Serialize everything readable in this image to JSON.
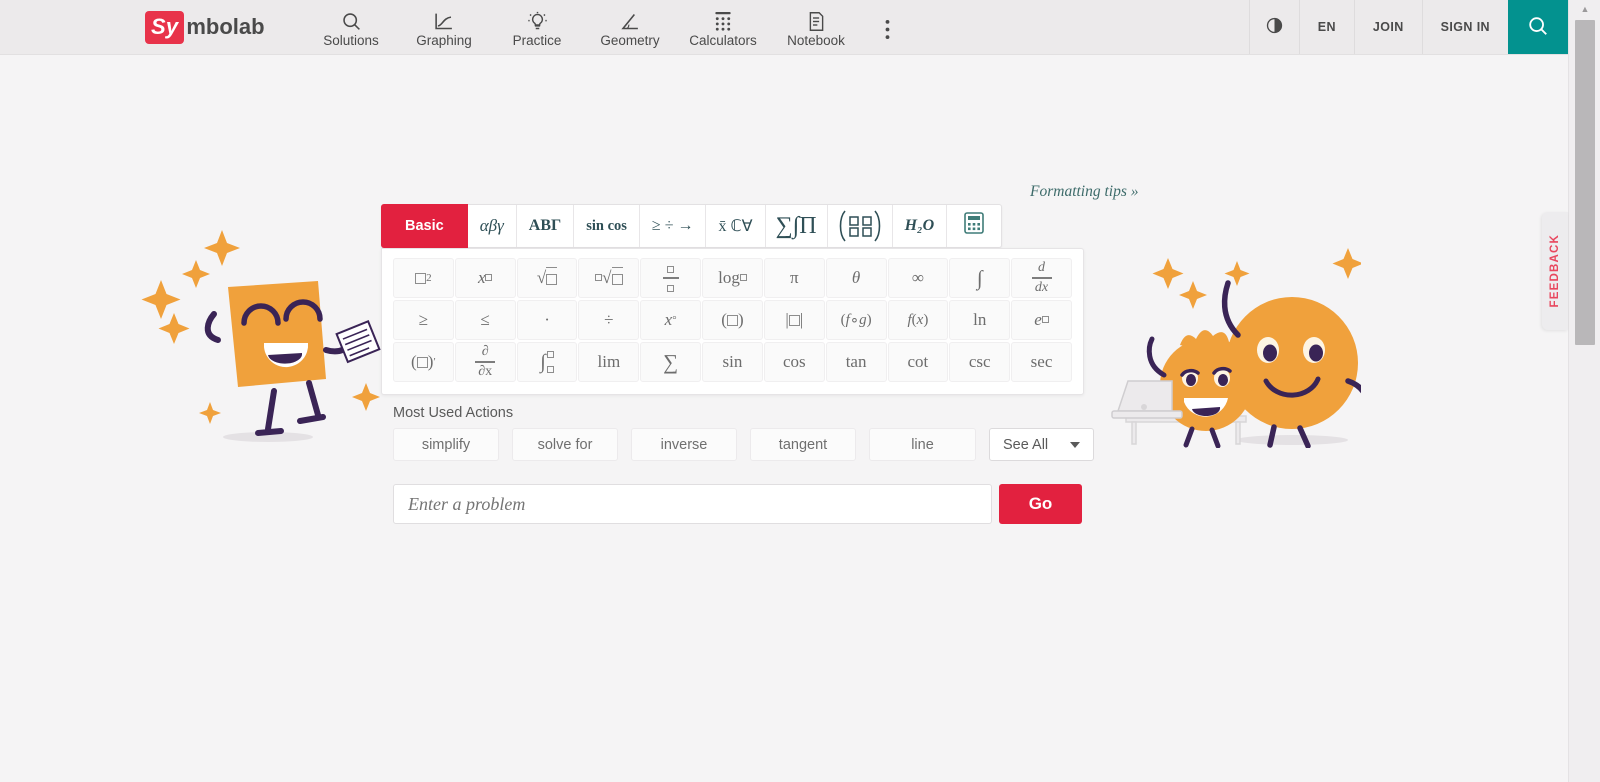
{
  "brand": {
    "name_prefix": "Sy",
    "name_suffix": "mbolab",
    "accent": "#e2213f",
    "teal": "#03928f"
  },
  "nav": {
    "items": [
      {
        "label": "Solutions",
        "icon": "search-icon"
      },
      {
        "label": "Graphing",
        "icon": "graph-line-icon"
      },
      {
        "label": "Practice",
        "icon": "lightbulb-icon"
      },
      {
        "label": "Geometry",
        "icon": "angle-icon"
      },
      {
        "label": "Calculators",
        "icon": "calculator-grid-icon"
      },
      {
        "label": "Notebook",
        "icon": "notebook-icon"
      }
    ],
    "kebab": "more-menu-icon",
    "right": {
      "contrast": "contrast-icon",
      "language": "EN",
      "join": "JOIN",
      "signin": "SIGN IN",
      "search": "search-icon"
    }
  },
  "feedback": {
    "label": "FEEDBACK",
    "color": "#e8475e"
  },
  "tips": {
    "label": "Formatting tips »"
  },
  "keyboard": {
    "tabs": [
      {
        "label": "Basic",
        "active": true
      },
      {
        "label": "αβγ",
        "active": false
      },
      {
        "label": "ΑΒΓ",
        "active": false
      },
      {
        "label": "sin cos",
        "active": false
      },
      {
        "label": "≥ ÷ →",
        "active": false
      },
      {
        "label": "x̄ ℂ∀",
        "active": false
      },
      {
        "label": "∑∫Π",
        "active": false
      },
      {
        "label": "matrix-brackets",
        "active": false
      },
      {
        "label": "H₂O",
        "active": false
      },
      {
        "label": "calculator-icon",
        "active": false
      }
    ],
    "rows": [
      [
        "□²",
        "x□",
        "√□",
        "ⁿ√□",
        "□/□",
        "log□",
        "π",
        "θ",
        "∞",
        "∫",
        "d/dx"
      ],
      [
        "≥",
        "≤",
        "·",
        "÷",
        "x°",
        "(□)",
        "|□|",
        "(f∘g)",
        "f(x)",
        "ln",
        "e□"
      ],
      [
        "(□)′",
        "∂/∂x",
        "∫□□",
        "lim",
        "∑",
        "sin",
        "cos",
        "tan",
        "cot",
        "csc",
        "sec"
      ]
    ]
  },
  "most_used": {
    "title": "Most Used Actions",
    "actions": [
      "simplify",
      "solve for",
      "inverse",
      "tangent",
      "line"
    ],
    "see_all": "See All"
  },
  "problem_input": {
    "placeholder": "Enter a problem",
    "value": ""
  },
  "go_button": {
    "label": "Go"
  }
}
